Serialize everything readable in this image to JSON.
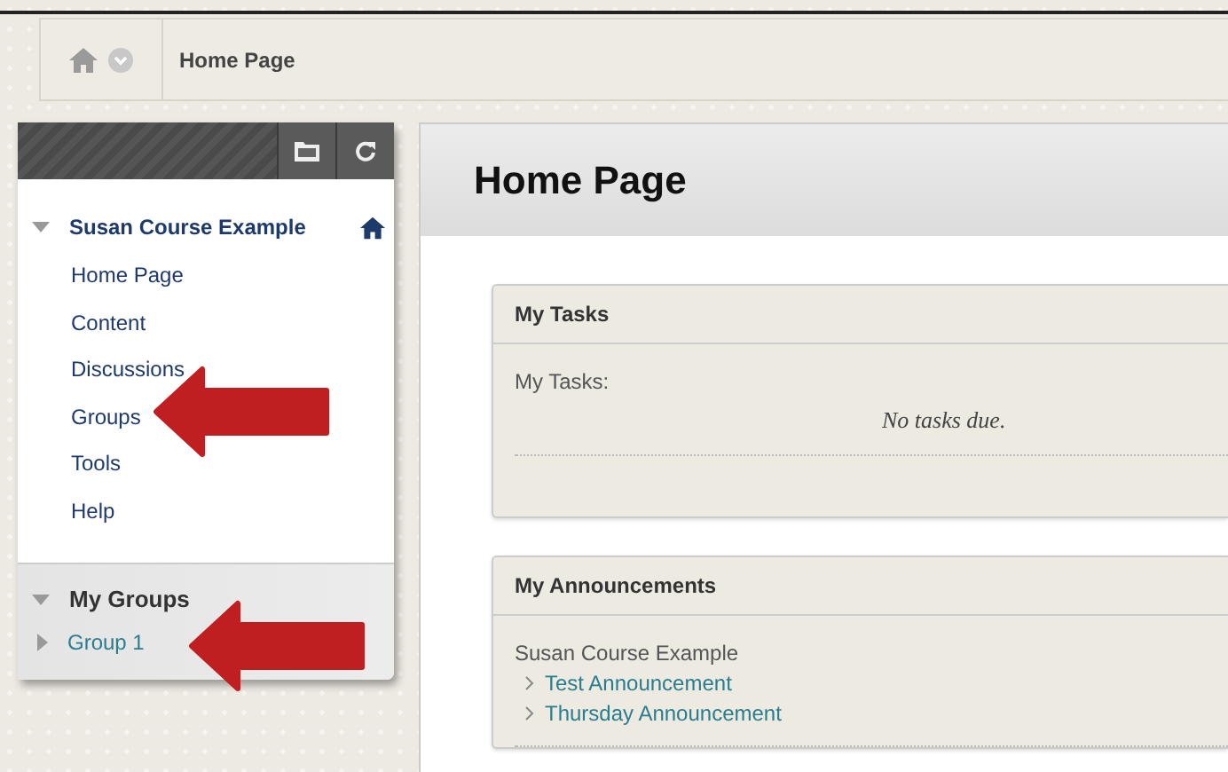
{
  "breadcrumb": {
    "current": "Home Page"
  },
  "course_menu": {
    "title": "Susan Course Example",
    "expanded": true,
    "items": [
      {
        "label": "Home Page"
      },
      {
        "label": "Content"
      },
      {
        "label": "Discussions"
      },
      {
        "label": "Groups"
      },
      {
        "label": "Tools"
      },
      {
        "label": "Help"
      }
    ]
  },
  "my_groups": {
    "title": "My Groups",
    "expanded": true,
    "items": [
      {
        "label": "Group 1",
        "expanded": false
      }
    ]
  },
  "page_title": "Home Page",
  "modules": [
    {
      "title": "My Tasks",
      "kind": "tasks",
      "label": "My Tasks:",
      "message": "No tasks due."
    },
    {
      "title": "My Announcements",
      "kind": "announcements",
      "course": "Susan Course Example",
      "links": [
        "Test Announcement",
        "Thursday Announcement"
      ]
    }
  ]
}
